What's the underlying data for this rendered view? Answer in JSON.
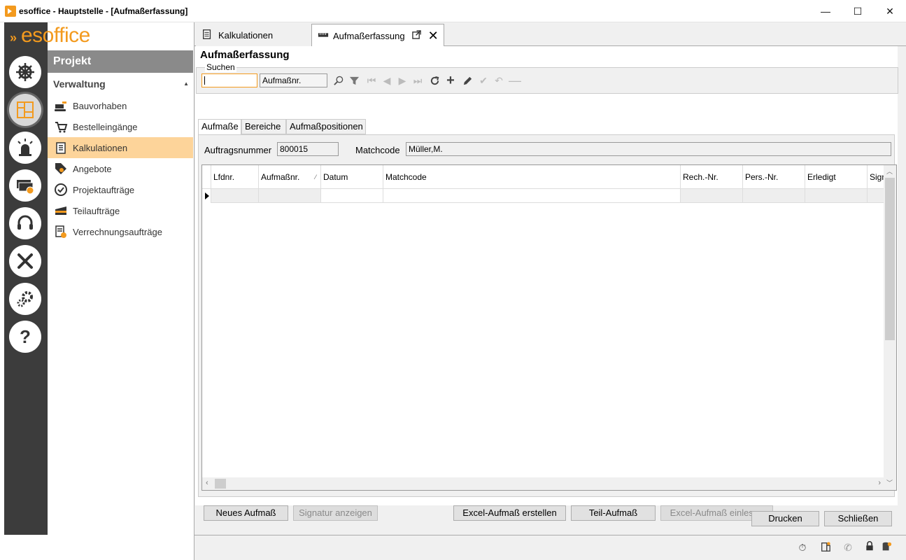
{
  "window": {
    "title": "esoffice - Hauptstelle - [Aufmaßerfassung]",
    "minimize": "—",
    "maximize": "☐",
    "close": "✕"
  },
  "brand": {
    "logo_text": "esoffice",
    "accent": "#f39a1e"
  },
  "rail": {
    "items": [
      "helm-icon",
      "floorplan-icon",
      "alarm-light-icon",
      "cash-icon",
      "headset-icon",
      "tools-icon",
      "gears-icon",
      "help-icon"
    ]
  },
  "menu": {
    "header": "Projekt",
    "section": "Verwaltung",
    "items": [
      {
        "label": "Bauvorhaben"
      },
      {
        "label": "Bestelleingänge"
      },
      {
        "label": "Kalkulationen"
      },
      {
        "label": "Angebote"
      },
      {
        "label": "Projektaufträge"
      },
      {
        "label": "Teilaufträge"
      },
      {
        "label": "Verrechnungsaufträge"
      }
    ]
  },
  "tabs": [
    {
      "label": "Kalkulationen"
    },
    {
      "label": "Aufmaßerfassung"
    }
  ],
  "form": {
    "title": "Aufmaßerfassung",
    "search_legend": "Suchen",
    "search_value": "",
    "search_field": "Aufmaßnr.",
    "subtabs": [
      "Aufmaße",
      "Bereiche",
      "Aufmaßpositionen"
    ],
    "auftragsnummer_label": "Auftragsnummer",
    "auftragsnummer_value": "800015",
    "matchcode_label": "Matchcode",
    "matchcode_value": "Müller,M."
  },
  "grid": {
    "columns": [
      "Lfdnr.",
      "Aufmaßnr.",
      "Datum",
      "Matchcode",
      "Rech.-Nr.",
      "Pers.-Nr.",
      "Erledigt",
      "Sign"
    ],
    "rows": []
  },
  "buttons": {
    "neues_aufmass": "Neues Aufmaß",
    "signatur_anzeigen": "Signatur anzeigen",
    "excel_erstellen": "Excel-Aufmaß erstellen",
    "teil_aufmass": "Teil-Aufmaß",
    "excel_einlesen": "Excel-Aufmaß einlesen",
    "drucken": "Drucken",
    "schliessen": "Schließen"
  }
}
